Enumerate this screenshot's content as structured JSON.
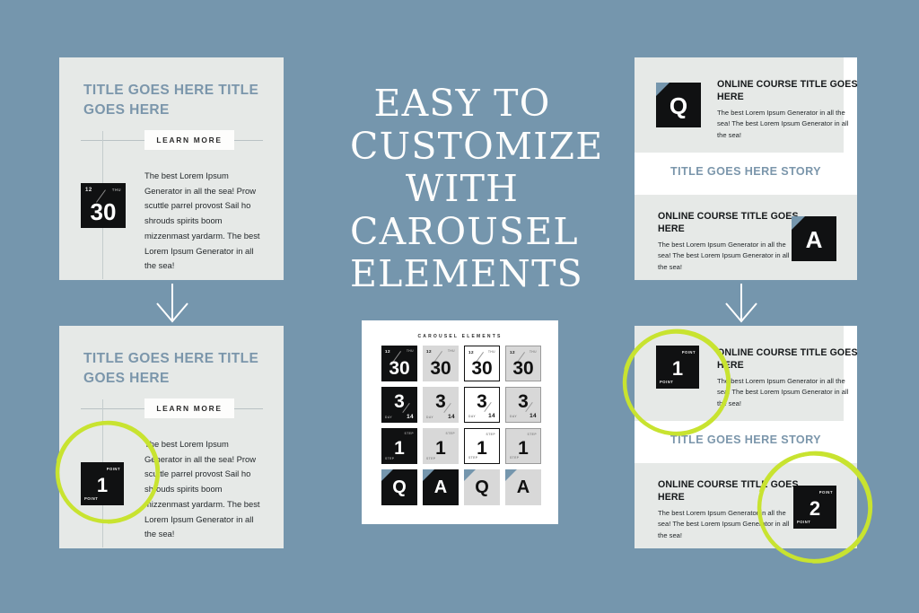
{
  "theme": {
    "background": "#7596ad",
    "panel": "#e6e9e7",
    "white": "#ffffff",
    "accent_blue": "#7b96ab",
    "badge_black": "#101112",
    "highlight_green": "#c8e330"
  },
  "center": {
    "headline_lines": [
      "EASY TO",
      "CUSTOMIZE",
      "WITH",
      "CAROUSEL",
      "ELEMENTS"
    ],
    "sheet_title": "CAROUSEL ELEMENTS"
  },
  "left_cards": [
    {
      "title": "TITLE GOES HERE TITLE GOES HERE",
      "button_label": "LEARN MORE",
      "body": "The best Lorem Ipsum Generator in all the sea! Prow scuttle parrel provost Sail ho shrouds spirits boom mizzenmast yardarm. The best Lorem Ipsum Generator in all the sea!",
      "badge": {
        "number": "30",
        "top_left": "12",
        "top_right": "THU",
        "style": "date"
      }
    },
    {
      "title": "TITLE GOES HERE TITLE GOES HERE",
      "button_label": "LEARN MORE",
      "body": "The best Lorem Ipsum Generator in all the sea! Prow scuttle parrel provost Sail ho shrouds spirits boom mizzenmast yardarm. The best Lorem Ipsum Generator in all the sea!",
      "badge": {
        "number": "1",
        "top_right": "POINT",
        "bottom_left": "POINT",
        "style": "point"
      },
      "highlighted": true
    }
  ],
  "right_cards": [
    {
      "story_label": "TITLE GOES HERE STORY",
      "items": [
        {
          "heading": "ONLINE COURSE TITLE GOES HERE",
          "body": "The best Lorem Ipsum Generator in all the sea! The best Lorem Ipsum Generator in all the sea!",
          "badge": {
            "letter": "Q",
            "style": "qa"
          },
          "align": "left"
        },
        {
          "heading": "ONLINE COURSE TITLE GOES HERE",
          "body": "The best Lorem Ipsum Generator in all the sea! The best Lorem Ipsum Generator in all the sea!",
          "badge": {
            "letter": "A",
            "style": "qa"
          },
          "align": "right"
        }
      ]
    },
    {
      "story_label": "TITLE GOES HERE STORY",
      "items": [
        {
          "heading": "ONLINE COURSE TITLE GOES HERE",
          "body": "The best Lorem Ipsum Generator in all the sea! The best Lorem Ipsum Generator in all the sea!",
          "badge": {
            "number": "1",
            "top_right": "POINT",
            "bottom_left": "POINT",
            "style": "point"
          },
          "align": "left",
          "highlighted": true
        },
        {
          "heading": "ONLINE COURSE TITLE GOES HERE",
          "body": "The best Lorem Ipsum Generator in all the sea! The best Lorem Ipsum Generator in all the sea!",
          "badge": {
            "number": "2",
            "top_right": "POINT",
            "bottom_left": "POINT",
            "style": "point"
          },
          "align": "right",
          "highlighted": true
        }
      ]
    }
  ],
  "grid": {
    "rows": [
      {
        "kind": "date",
        "number": "30",
        "top_left": "12",
        "top_right": "THU",
        "variants": [
          "black",
          "gray",
          "outline",
          "gray-outline"
        ]
      },
      {
        "kind": "day",
        "number": "3",
        "bottom_left": "DAY",
        "bottom_right": "14",
        "variants": [
          "black",
          "gray",
          "outline",
          "gray-outline"
        ]
      },
      {
        "kind": "step",
        "number": "1",
        "top_right": "STEP",
        "bottom_left": "STEP",
        "variants": [
          "black",
          "gray",
          "outline",
          "gray-outline"
        ]
      },
      {
        "kind": "qa",
        "letters": [
          "Q",
          "A",
          "Q",
          "A"
        ],
        "variants": [
          "black",
          "black",
          "gray",
          "gray"
        ]
      }
    ]
  },
  "arrows": [
    {
      "name": "arrow-left-column",
      "direction": "down"
    },
    {
      "name": "arrow-right-column",
      "direction": "down"
    }
  ]
}
